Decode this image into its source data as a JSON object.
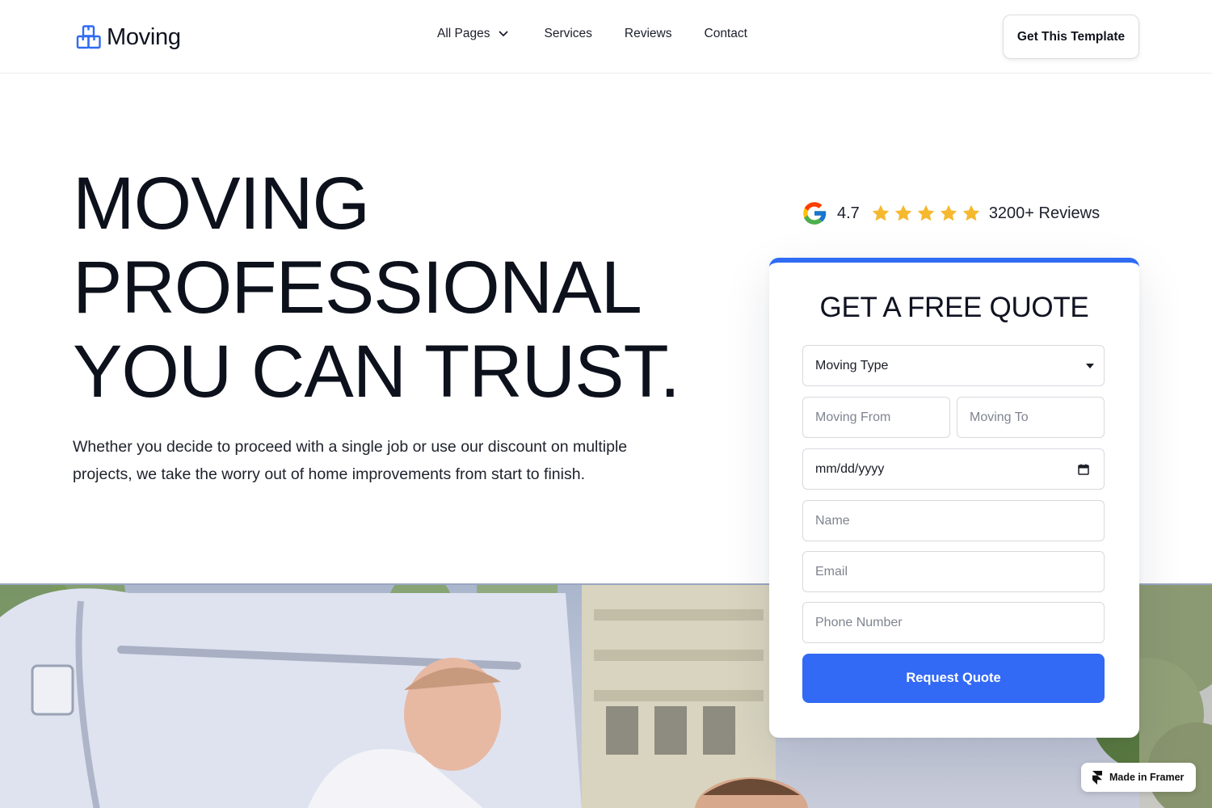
{
  "header": {
    "logo_text": "Moving",
    "nav": [
      {
        "label": "All Pages",
        "has_dropdown": true
      },
      {
        "label": "Services"
      },
      {
        "label": "Reviews"
      },
      {
        "label": "Contact"
      }
    ],
    "cta_label": "Get This Template"
  },
  "hero": {
    "title_lines": [
      "MOVING",
      "PROFESSIONAL",
      "YOU CAN TRUST."
    ],
    "subtitle": "Whether you decide to proceed with a single job or use our discount on multiple projects, we take the worry out of home improvements from start to finish."
  },
  "rating": {
    "score": "4.7",
    "stars": 5,
    "reviews_label": "3200+ Reviews",
    "star_color": "#f5b82e"
  },
  "quote_form": {
    "title": "GET A FREE QUOTE",
    "moving_type": "Moving Type",
    "moving_from_placeholder": "Moving From",
    "moving_to_placeholder": "Moving To",
    "date_placeholder": "mm/dd/yyyy",
    "name_placeholder": "Name",
    "email_placeholder": "Email",
    "phone_placeholder": "Phone Number",
    "submit_label": "Request Quote"
  },
  "badge": {
    "label": "Made in Framer"
  },
  "colors": {
    "accent": "#3269f5",
    "text": "#0f1220"
  },
  "icons": [
    "boxes-logo-icon",
    "chevron-down-icon",
    "google-icon",
    "star-icon",
    "caret-down-icon",
    "calendar-icon",
    "framer-icon"
  ]
}
